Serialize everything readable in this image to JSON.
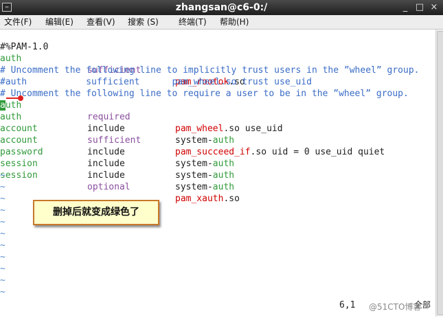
{
  "window": {
    "title": "zhangsan@c6-0:/",
    "minimize": "_",
    "maximize": "□",
    "close": "×"
  },
  "menu": [
    {
      "label": "文件(F)"
    },
    {
      "label": "编辑(E)"
    },
    {
      "label": "查看(V)"
    },
    {
      "label": "搜索 (S)"
    },
    {
      "label": "终端(T)"
    },
    {
      "label": "帮助(H)"
    }
  ],
  "editor": {
    "header": "#%PAM-1.0",
    "lines": {
      "l1": {
        "type": "auth",
        "control": "sufficient",
        "module": "pam_rootok",
        "ext": ".so"
      },
      "l2": {
        "text": "# Uncomment the following line to implicitly trust users in the ”wheel” group."
      },
      "l3": {
        "text": "#auth           sufficient      pam_wheel.so trust use_uid"
      },
      "l4": {
        "text": "# Uncomment the following line to require a user to be in the ”wheel” group."
      },
      "l5": {
        "type_cursor": "a",
        "type_rest": "uth",
        "control": "required",
        "module": "pam_wheel",
        "ext": ".so",
        "args": " use_uid"
      },
      "l6": {
        "type": "auth",
        "control": "include",
        "module_prefix": "system-",
        "module_suffix": "auth"
      },
      "l7": {
        "type": "account",
        "control": "sufficient",
        "module": "pam_succeed_if",
        "ext": ".so",
        "args": " uid = 0 use_uid quiet"
      },
      "l8": {
        "type": "account",
        "control": "include",
        "module_prefix": "system-",
        "module_suffix": "auth"
      },
      "l9": {
        "type": "password",
        "control": "include",
        "module_prefix": "system-",
        "module_suffix": "auth"
      },
      "l10": {
        "type": "session",
        "control": "include",
        "module_prefix": "system-",
        "module_suffix": "auth"
      },
      "l11": {
        "type": "session",
        "control": "optional",
        "module": "pam_xauth",
        "ext": ".so"
      }
    },
    "tilde": "~"
  },
  "annotation": {
    "text": "删掉后就变成绿色了"
  },
  "status": {
    "position": "6,1",
    "scroll": "全部"
  },
  "watermark": "@51CTO博客",
  "colors": {
    "comment": "#3a6cc6",
    "keyword": "#2f9a39",
    "control": "#8a4e9e",
    "module": "#d00000",
    "annotation_border": "#c87828",
    "arrow": "#e02020"
  }
}
